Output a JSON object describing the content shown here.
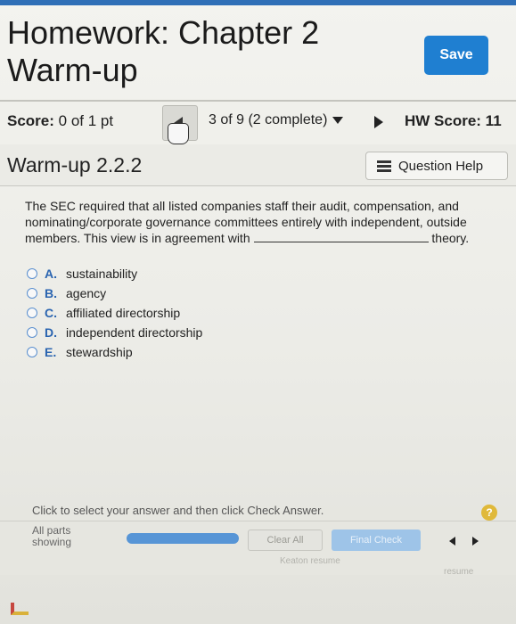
{
  "header": {
    "title": "Homework: Chapter 2 Warm-up",
    "save_label": "Save"
  },
  "score_bar": {
    "score_label": "Score:",
    "score_value": "0 of 1 pt",
    "progress_label": "3 of 9 (2 complete)",
    "hw_score_label": "HW Score: 11"
  },
  "question": {
    "title": "Warm-up 2.2.2",
    "help_label": "Question Help",
    "text_before": "The SEC required that all listed companies staff their audit, compensation, and nominating/corporate governance committees entirely with independent, outside members. This view is in agreement with",
    "text_after": "theory.",
    "options": [
      {
        "letter": "A.",
        "label": "sustainability"
      },
      {
        "letter": "B.",
        "label": "agency"
      },
      {
        "letter": "C.",
        "label": "affiliated directorship"
      },
      {
        "letter": "D.",
        "label": "independent directorship"
      },
      {
        "letter": "E.",
        "label": "stewardship"
      }
    ],
    "instruction": "Click to select your answer and then click Check Answer."
  },
  "footer": {
    "parts_label": "All parts showing",
    "clear_label": "Clear All",
    "final_label": "Final Check",
    "faded_text_1": "Keaton resume",
    "faded_text_2": "resume",
    "help_icon_glyph": "?"
  },
  "icons": {
    "prev": "triangle-left-icon",
    "next": "triangle-right-icon",
    "dropdown": "caret-down-icon",
    "help": "list-icon",
    "cursor": "hand-cursor-icon"
  },
  "colors": {
    "accent": "#1f7fd1",
    "option_letter": "#2a64b0",
    "help_badge": "#e0b93a"
  }
}
